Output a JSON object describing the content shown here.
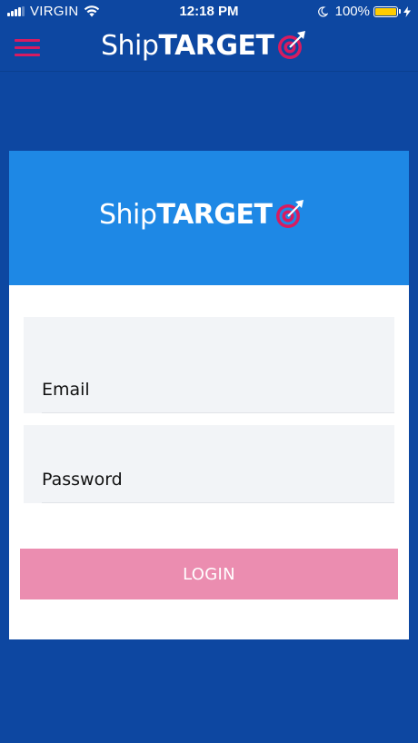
{
  "status_bar": {
    "carrier": "VIRGIN",
    "time": "12:18 PM",
    "battery": "100%",
    "battery_level": 1.0,
    "signal_icon": "cellular-signal-icon",
    "wifi_icon": "wifi-icon",
    "moon_icon": "do-not-disturb-moon-icon",
    "charging_icon": "charging-bolt-icon"
  },
  "header": {
    "menu_icon": "hamburger-menu-icon",
    "logo_ship": "Ship",
    "logo_target": "TARGET",
    "logo_icon": "target-arrow-icon"
  },
  "card": {
    "logo_ship": "Ship",
    "logo_target": "TARGET",
    "email_placeholder": "Email",
    "password_placeholder": "Password",
    "login_label": "LOGIN"
  },
  "colors": {
    "background": "#0d47a1",
    "banner": "#1e88e5",
    "accent": "#d81b60",
    "button": "#eb8db0",
    "battery": "#ffcc00"
  }
}
